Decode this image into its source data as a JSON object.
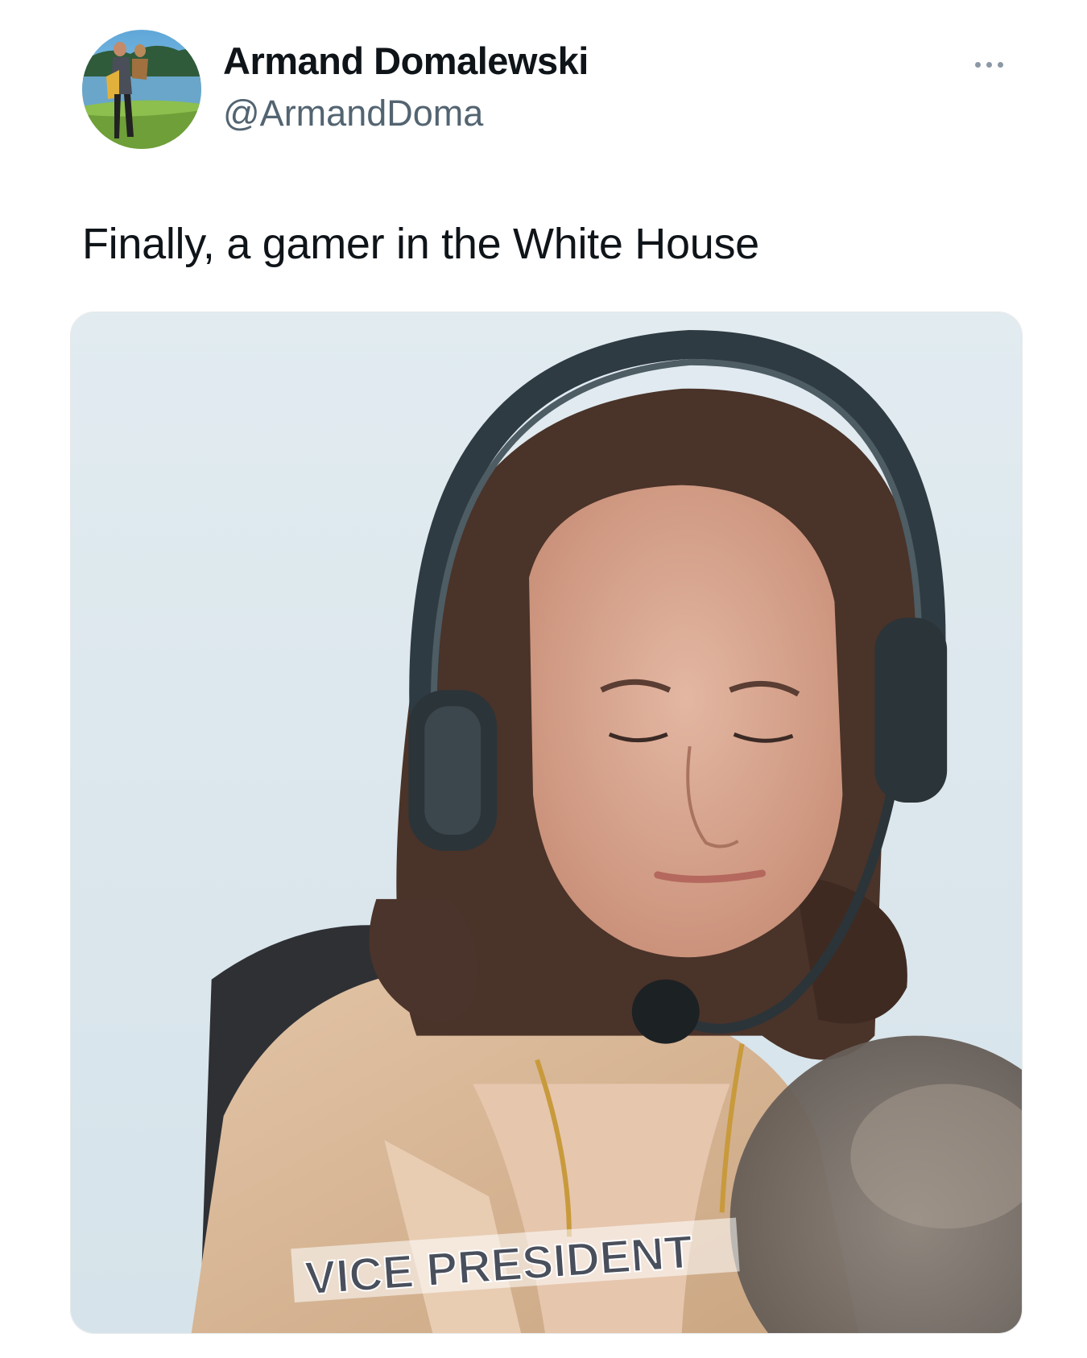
{
  "author": {
    "display_name": "Armand Domalewski",
    "handle": "@ArmandDoma",
    "avatar_icon": "profile-photo-icon"
  },
  "more_icon": "ellipsis-icon",
  "tweet": {
    "text": "Finally, a gamer in the White House"
  },
  "media": {
    "lower_third_text": "VICE PRESIDENT"
  },
  "colors": {
    "name": "#0f1419",
    "handle": "#536471",
    "background": "#ffffff"
  }
}
